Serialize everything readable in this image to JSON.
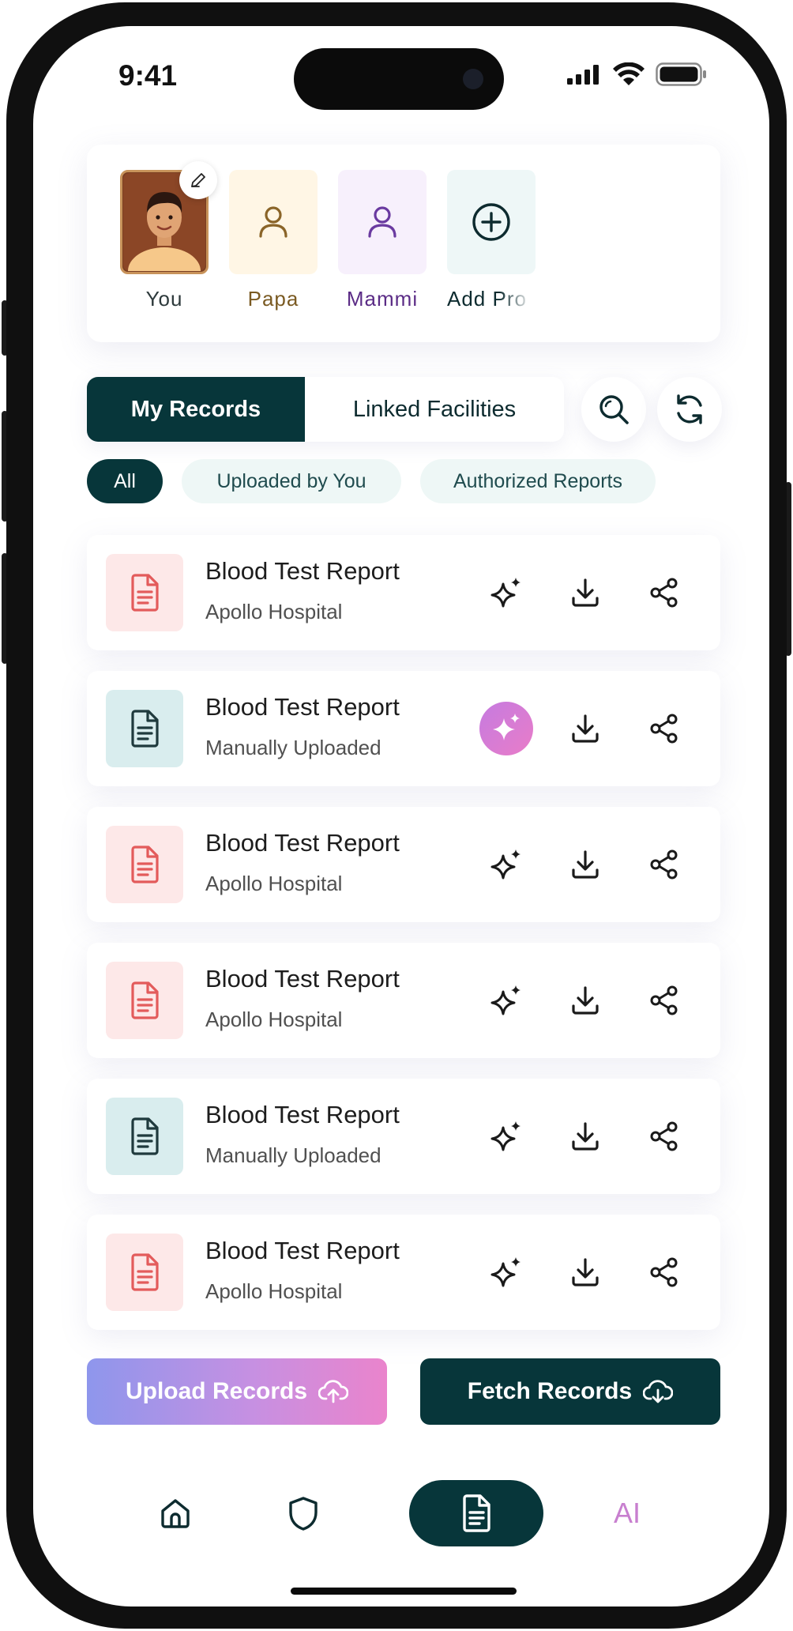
{
  "status_bar": {
    "time": "9:41"
  },
  "profiles": [
    {
      "name": "You",
      "color": "#3a3a3a",
      "tile_bg": "#7a3f22",
      "icon": "avatar-photo",
      "has_edit": true
    },
    {
      "name": "Papa",
      "color": "#7a5a22",
      "tile_bg": "#fff6e5",
      "icon": "person-icon",
      "icon_color": "#8a6428"
    },
    {
      "name": "Mammi",
      "color": "#5b2c86",
      "tile_bg": "#f7f0fc",
      "icon": "person-icon",
      "icon_color": "#6a3aa0"
    },
    {
      "name": "Add Pro",
      "color": "#0d2b2f",
      "tile_bg": "#eef7f7",
      "icon": "plus-circle-icon",
      "icon_color": "#0d2b2f"
    }
  ],
  "tabs": [
    {
      "label": "My Records",
      "active": true
    },
    {
      "label": "Linked Facilities",
      "active": false
    }
  ],
  "filters": [
    {
      "label": "All",
      "active": true
    },
    {
      "label": "Uploaded by You",
      "active": false
    },
    {
      "label": "Authorized Reports",
      "active": false
    }
  ],
  "records": [
    {
      "title": "Blood Test Report",
      "source": "Apollo Hospital",
      "kind": "facility",
      "ai_highlighted": false
    },
    {
      "title": "Blood Test Report",
      "source": "Manually Uploaded",
      "kind": "manual",
      "ai_highlighted": true
    },
    {
      "title": "Blood Test Report",
      "source": "Apollo Hospital",
      "kind": "facility",
      "ai_highlighted": false
    },
    {
      "title": "Blood Test Report",
      "source": "Apollo Hospital",
      "kind": "facility",
      "ai_highlighted": false
    },
    {
      "title": "Blood Test Report",
      "source": "Manually Uploaded",
      "kind": "manual",
      "ai_highlighted": false
    },
    {
      "title": "Blood Test Report",
      "source": "Apollo Hospital",
      "kind": "facility",
      "ai_highlighted": false
    }
  ],
  "actions": {
    "upload_label": "Upload Records",
    "fetch_label": "Fetch Records"
  },
  "nav": {
    "items": [
      {
        "icon": "home-icon"
      },
      {
        "icon": "shield-icon"
      },
      {
        "icon": "document-icon",
        "active": true
      },
      {
        "label": "AI"
      }
    ]
  },
  "colors": {
    "primary_dark": "#07363a",
    "facility_icon": "#e35b5b",
    "facility_bg": "#fde8e8",
    "manual_icon": "#1f3a3d",
    "manual_bg": "#d9edee"
  }
}
